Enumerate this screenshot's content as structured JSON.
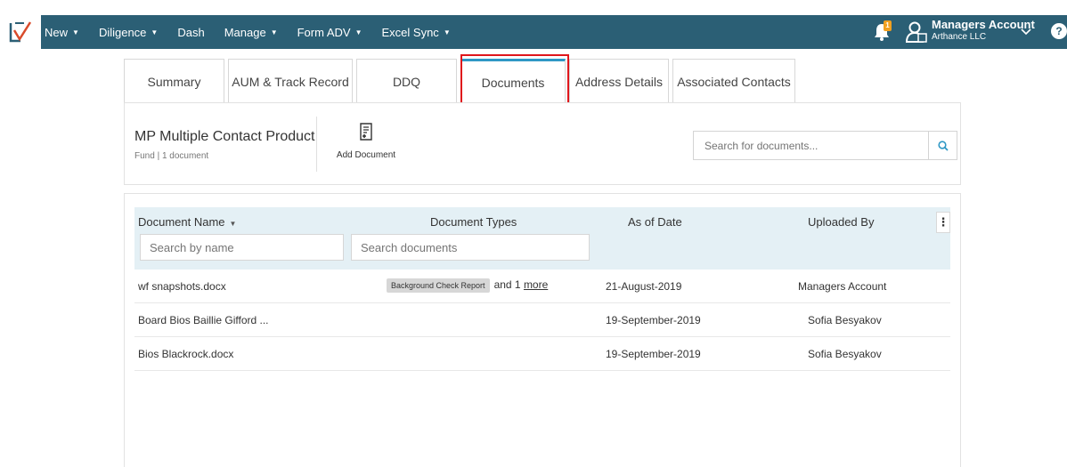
{
  "nav": {
    "items": [
      {
        "label": "New",
        "caret": true
      },
      {
        "label": "Diligence",
        "caret": true
      },
      {
        "label": "Dash",
        "caret": false
      },
      {
        "label": "Manage",
        "caret": true
      },
      {
        "label": "Form ADV",
        "caret": true
      },
      {
        "label": "Excel Sync",
        "caret": true
      }
    ],
    "notification_count": "1",
    "account_name": "Managers Account",
    "account_company": "Arthance LLC",
    "help_label": "?"
  },
  "tabs": [
    {
      "label": "Summary",
      "active": false
    },
    {
      "label": "AUM & Track Record",
      "active": false
    },
    {
      "label": "DDQ",
      "active": false
    },
    {
      "label": "Documents",
      "active": true
    },
    {
      "label": "Address Details",
      "active": false
    },
    {
      "label": "Associated Contacts",
      "active": false
    }
  ],
  "product": {
    "title": "MP Multiple Contact Product",
    "subtitle": "Fund | 1 document",
    "add_document_label": "Add Document"
  },
  "search": {
    "placeholder": "Search for documents..."
  },
  "table": {
    "columns": {
      "name": "Document Name",
      "types": "Document Types",
      "date": "As of Date",
      "uploaded_by": "Uploaded By"
    },
    "filters": {
      "name_placeholder": "Search by name",
      "types_placeholder": "Search documents"
    },
    "rows": [
      {
        "name": "wf snapshots.docx",
        "type_tag": "Background Check Report",
        "more_prefix": "and 1",
        "more_link": "more",
        "date": "21-August-2019",
        "uploaded_by": "Managers Account"
      },
      {
        "name": "Board Bios Baillie Gifford ...",
        "type_tag": "",
        "more_prefix": "",
        "more_link": "",
        "date": "19-September-2019",
        "uploaded_by": "Sofia Besyakov"
      },
      {
        "name": "Bios Blackrock.docx",
        "type_tag": "",
        "more_prefix": "",
        "more_link": "",
        "date": "19-September-2019",
        "uploaded_by": "Sofia Besyakov"
      }
    ]
  },
  "colors": {
    "nav_bg": "#2b5f75",
    "active_tab": "#2f98c5",
    "highlight": "#e0161b",
    "header_bg": "#e4f0f5",
    "badge": "#f0a020"
  }
}
